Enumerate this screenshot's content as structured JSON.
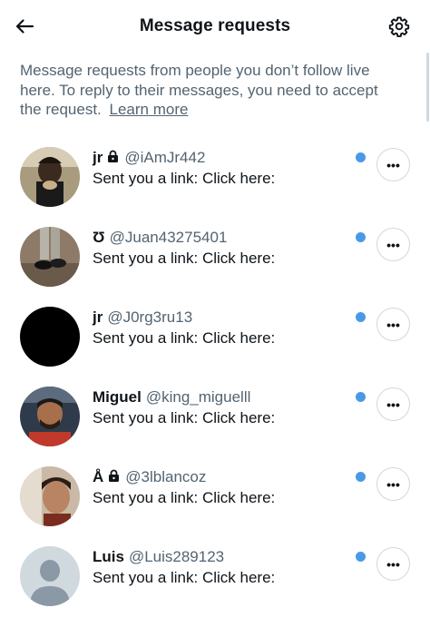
{
  "header": {
    "title": "Message requests",
    "back_icon": "arrow-left-icon",
    "settings_icon": "gear-icon"
  },
  "intro": {
    "text": "Message requests from people you don’t follow live here. To reply to their messages, you need to accept the request.",
    "learn_more": "Learn more"
  },
  "colors": {
    "unread_dot": "#4a99e9",
    "secondary_text": "#536471"
  },
  "requests": [
    {
      "name": "jr",
      "locked": true,
      "handle": "@iAmJr442",
      "preview": "Sent you a link: Click here:",
      "unread": true,
      "more_label": "•••"
    },
    {
      "name": "Ʊ",
      "locked": false,
      "handle": "@Juan43275401",
      "preview": "Sent you a link: Click here:",
      "unread": true,
      "more_label": "•••"
    },
    {
      "name": "jr",
      "locked": false,
      "handle": "@J0rg3ru13",
      "preview": "Sent you a link: Click here:",
      "unread": true,
      "more_label": "•••"
    },
    {
      "name": "Miguel",
      "locked": false,
      "handle": "@king_miguelll",
      "preview": "Sent you a link: Click here:",
      "unread": true,
      "more_label": "•••"
    },
    {
      "name": "Å",
      "locked": true,
      "handle": "@3lblancoz",
      "preview": "Sent you a link: Click here:",
      "unread": true,
      "more_label": "•••"
    },
    {
      "name": "Luis",
      "locked": false,
      "handle": "@Luis289123",
      "preview": "Sent you a link: Click here:",
      "unread": true,
      "more_label": "•••"
    }
  ]
}
